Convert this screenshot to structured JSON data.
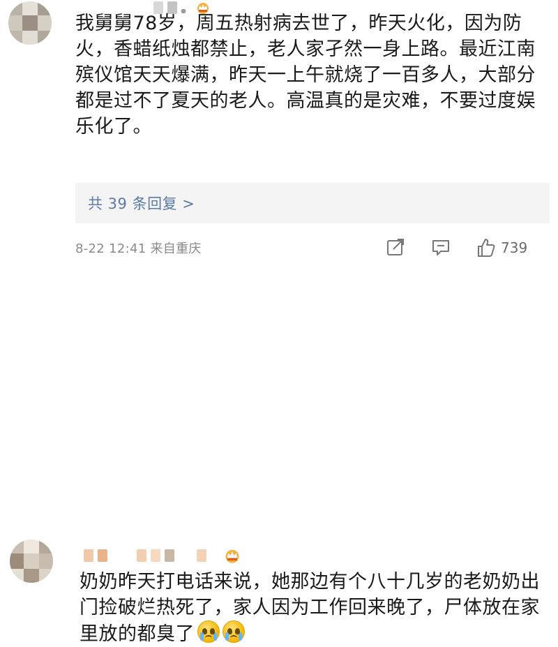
{
  "comments": [
    {
      "text": "我舅舅78岁，周五热射病去世了，昨天火化，因为防火，香蜡纸烛都禁止，老人家孑然一身上路。最近江南殡仪馆天天爆满，昨天一上午就烧了一百多人，大部分都是过不了夏天的老人。高温真的是灾难，不要过度娱乐化了。",
      "replies_label": "共 39 条回复 >",
      "meta": "8-22 12:41 来自重庆",
      "likes": "739"
    },
    {
      "text": "奶奶昨天打电话来说，她那边有个八十几岁的老奶奶出门捡破烂热死了，家人因为工作回来晚了，尸体放在家里放的都臭了",
      "emoji_count": 2
    }
  ],
  "icons": {
    "share": "share-icon",
    "comment": "comment-icon",
    "like": "thumbs-up-icon",
    "badge": "crown-badge-icon",
    "emoji": "crying-face-emoji-icon"
  },
  "colors": {
    "reply_link": "#5b7aa8",
    "meta": "#8a8a8a",
    "reply_bg": "#f4f4f4",
    "badge": "#f0a020"
  }
}
